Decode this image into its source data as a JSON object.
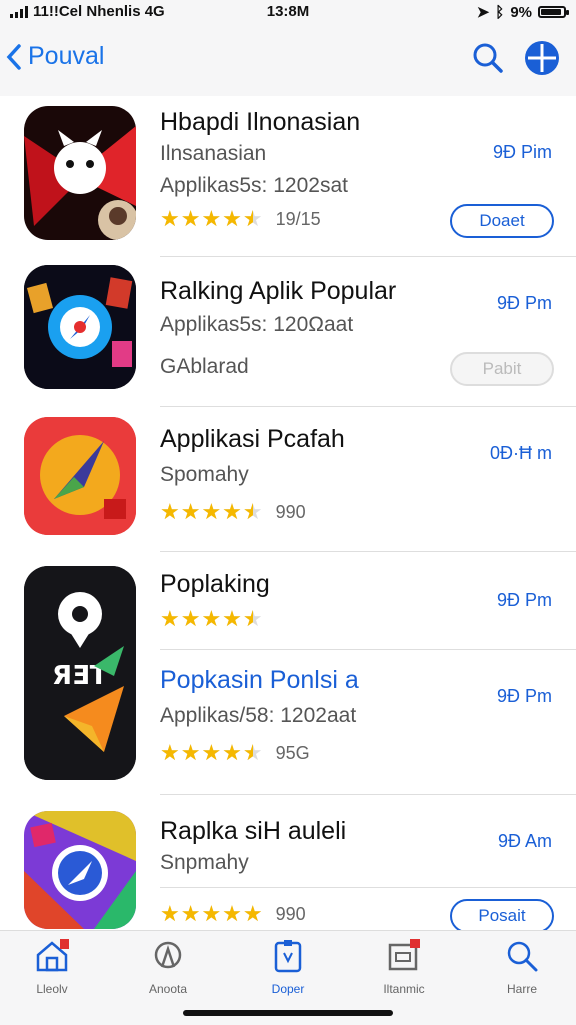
{
  "status": {
    "carrier": "11!!Cel Nhenlis 4G",
    "time": "13:8M",
    "battery": "9%",
    "battery_level": 0.9
  },
  "nav": {
    "back_label": "Pouval"
  },
  "apps": [
    {
      "title": "Hbapdi Ilnonasian",
      "subtitle": "Ilnsanasian",
      "detail": "Applikas5s: 1202sat",
      "time": "9Đ Pim",
      "rating": 4.5,
      "count": "19/15",
      "button": "Doaet",
      "button_disabled": false
    },
    {
      "title": "Ralking Aplik Popular",
      "subtitle": "Applikas5s: 120Ωaat",
      "detail": "GAblarad",
      "time": "9Ð Pm",
      "button": "Pabit",
      "button_disabled": true
    },
    {
      "title": "Applikasi Pcafah",
      "subtitle": "Spomahy",
      "time": "0Ð·Ħ m",
      "rating": 4.5,
      "count": "990"
    },
    {
      "title": "Poplaking",
      "time": "9Ð Pm",
      "rating": 4.5
    },
    {
      "title": "Popkasin Ponlsi a",
      "subtitle": "Applikas/58: 1202aat",
      "time": "9Ð Pm",
      "rating": 4.5,
      "count": "95G"
    },
    {
      "title": "Raplka siH auleli",
      "subtitle": "Snpmahy",
      "time": "9Ð Am",
      "rating": 5,
      "count": "990",
      "button": "Posait",
      "button_disabled": false
    }
  ],
  "tabs": [
    {
      "label": "Lleolv",
      "icon": "home-icon",
      "badge": true
    },
    {
      "label": "Anoota",
      "icon": "compass-icon",
      "badge": false
    },
    {
      "label": "Doper",
      "icon": "apps-icon",
      "badge": false
    },
    {
      "label": "Iltanmic",
      "icon": "updates-icon",
      "badge": true
    },
    {
      "label": "Harre",
      "icon": "search-icon",
      "badge": false
    }
  ],
  "colors": {
    "accent": "#1a5fd6",
    "star": "#f5b800"
  }
}
